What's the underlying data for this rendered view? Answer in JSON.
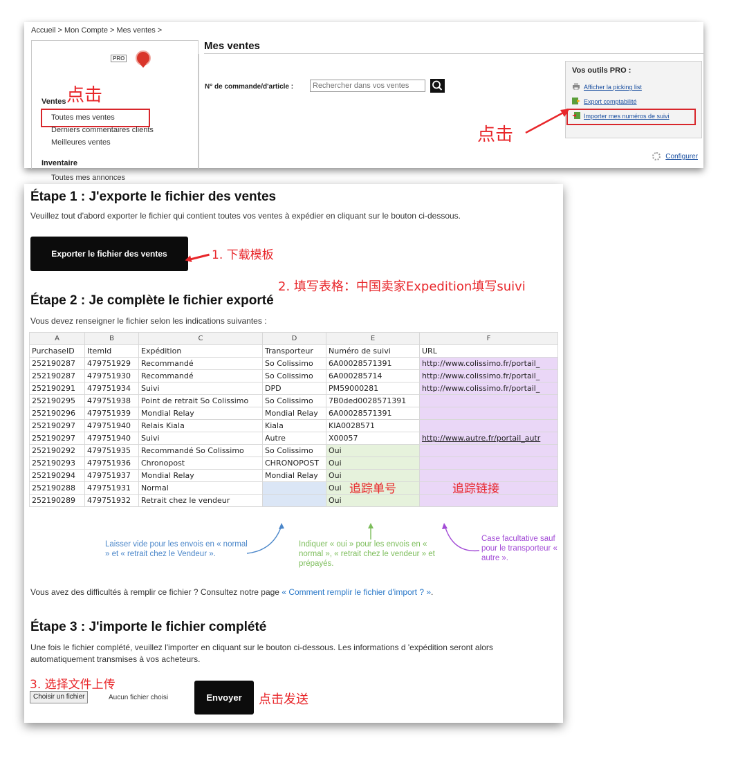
{
  "panel1": {
    "breadcrumb": "Accueil > Mon Compte > Mes ventes >",
    "pro_badge": "PRO",
    "sidebar": {
      "section_ventes": "Ventes",
      "ventes_items": [
        "Toutes mes ventes",
        "Derniers commentaires clients",
        "Meilleures ventes"
      ],
      "section_inventaire": "Inventaire",
      "inventaire_items": [
        "Toutes mes annonces"
      ]
    },
    "annotation_click_left": "点击",
    "annotation_click_right": "点击",
    "main_title": "Mes ventes",
    "order_label": "N° de commande/d'article :",
    "search_placeholder": "Rechercher dans vos ventes",
    "tools_title": "Vos outils PRO :",
    "tools": [
      "Afficher la picking list",
      "Export comptabilité",
      "Importer mes numéros de suivi"
    ],
    "configure": "Configurer"
  },
  "step1": {
    "title": "Étape 1 : J'exporte le fichier des ventes",
    "text": "Veuillez tout d'abord exporter le fichier qui contient toutes vos ventes à expédier en cliquant sur le bouton ci-dessous.",
    "button": "Exporter le fichier des ventes",
    "annotation": "1. 下载模板"
  },
  "step2": {
    "annotation": "2. 填写表格：中国卖家Expedition填写suivi",
    "title": "Étape 2 : Je complète le fichier exporté",
    "text": "Vous devez renseigner le fichier selon les indications suivantes :",
    "columns": [
      "A",
      "B",
      "C",
      "D",
      "E",
      "F"
    ],
    "headers": [
      "PurchaseID",
      "ItemId",
      "Expédition",
      "Transporteur",
      "Numéro de suivi",
      "URL"
    ],
    "rows": [
      [
        "252190287",
        "479751929",
        "Recommandé",
        "So Colissimo",
        "6A00028571391",
        "http://www.colissimo.fr/portail_"
      ],
      [
        "252190287",
        "479751930",
        "Recommandé",
        "So Colissimo",
        "6A000285714",
        "http://www.colissimo.fr/portail_"
      ],
      [
        "252190291",
        "479751934",
        "Suivi",
        "DPD",
        "PM59000281",
        "http://www.colissimo.fr/portail_"
      ],
      [
        "252190295",
        "479751938",
        "Point de retrait So Colissimo",
        "So Colissimo",
        "7B0ded0028571391",
        ""
      ],
      [
        "252190296",
        "479751939",
        "Mondial Relay",
        "Mondial Relay",
        "6A00028571391",
        ""
      ],
      [
        "252190297",
        "479751940",
        "Relais Kiala",
        "Kiala",
        "KIA0028571",
        ""
      ],
      [
        "252190297",
        "479751940",
        "Suivi",
        "Autre",
        "X00057",
        "http://www.autre.fr/portail_autr"
      ],
      [
        "252190292",
        "479751935",
        "Recommandé So Colissimo",
        "So Colissimo",
        "Oui",
        ""
      ],
      [
        "252190293",
        "479751936",
        "Chronopost",
        "CHRONOPOST",
        "Oui",
        ""
      ],
      [
        "252190294",
        "479751937",
        "Mondial Relay",
        "Mondial Relay",
        "Oui",
        ""
      ],
      [
        "252190288",
        "479751931",
        "Normal",
        "",
        "Oui",
        ""
      ],
      [
        "252190289",
        "479751932",
        "Retrait chez le vendeur",
        "",
        "Oui",
        ""
      ]
    ],
    "overlay_tracking_number": "追踪单号",
    "overlay_tracking_link": "追踪链接",
    "note_blue": "Laisser vide pour les envois en « normal » et « retrait chez le Vendeur ».",
    "note_green": "Indiquer « oui » pour les envois en « normal », « retrait chez le vendeur » et prépayés.",
    "note_purple": "Case facultative sauf pour le transporteur « autre ».",
    "help_text": "Vous avez des difficultés à remplir ce fichier ? Consultez notre page ",
    "help_link": "« Comment remplir le fichier d'import ? »",
    "help_end": "."
  },
  "step3": {
    "title": "Étape 3 : J'importe le fichier complété",
    "text": "Une fois le fichier complété, veuillez l'importer en cliquant sur le bouton ci-dessous. Les informations d 'expédition seront alors automatiquement transmises à vos acheteurs.",
    "annotation": "3. 选择文件上传",
    "file_button": "Choisir un fichier",
    "file_status": "Aucun fichier choisi",
    "send_button": "Envoyer",
    "annotation_send": "点击发送"
  },
  "colors": {
    "annotation_red": "#e8262a",
    "link_blue": "#1a4fa0",
    "cell_blue": "#dbe6f6",
    "cell_green": "#e6f2dc",
    "cell_purple": "#ead7f7"
  }
}
